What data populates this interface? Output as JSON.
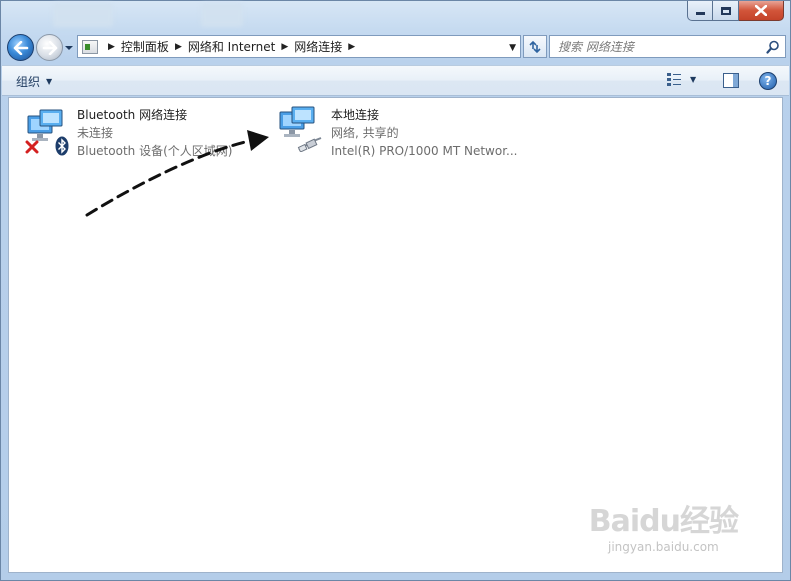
{
  "window": {
    "caption_buttons": [
      "minimize",
      "maximize",
      "close"
    ]
  },
  "navigation": {
    "back": "back",
    "forward": "forward",
    "breadcrumbs": [
      "控制面板",
      "网络和 Internet",
      "网络连接"
    ],
    "search_placeholder": "搜索 网络连接"
  },
  "toolbar": {
    "organize_label": "组织"
  },
  "connections": [
    {
      "name": "Bluetooth 网络连接",
      "status": "未连接",
      "device": "Bluetooth 设备(个人区域网)",
      "icon": "bluetooth-network-icon",
      "state_icon": "disconnected-x-icon"
    },
    {
      "name": "本地连接",
      "status": "网络, 共享的",
      "device": "Intel(R) PRO/1000 MT Networ...",
      "icon": "local-network-icon",
      "state_icon": "ethernet-cable-icon"
    }
  ],
  "annotation": {
    "arrow": "dashed-arrow"
  },
  "watermark": {
    "brand": "Baidu经验",
    "url": "jingyan.baidu.com"
  },
  "colors": {
    "frame": "#b9d1ec",
    "accent": "#2f64a0",
    "error_red": "#d42020",
    "muted_text": "#6d6d6d"
  }
}
